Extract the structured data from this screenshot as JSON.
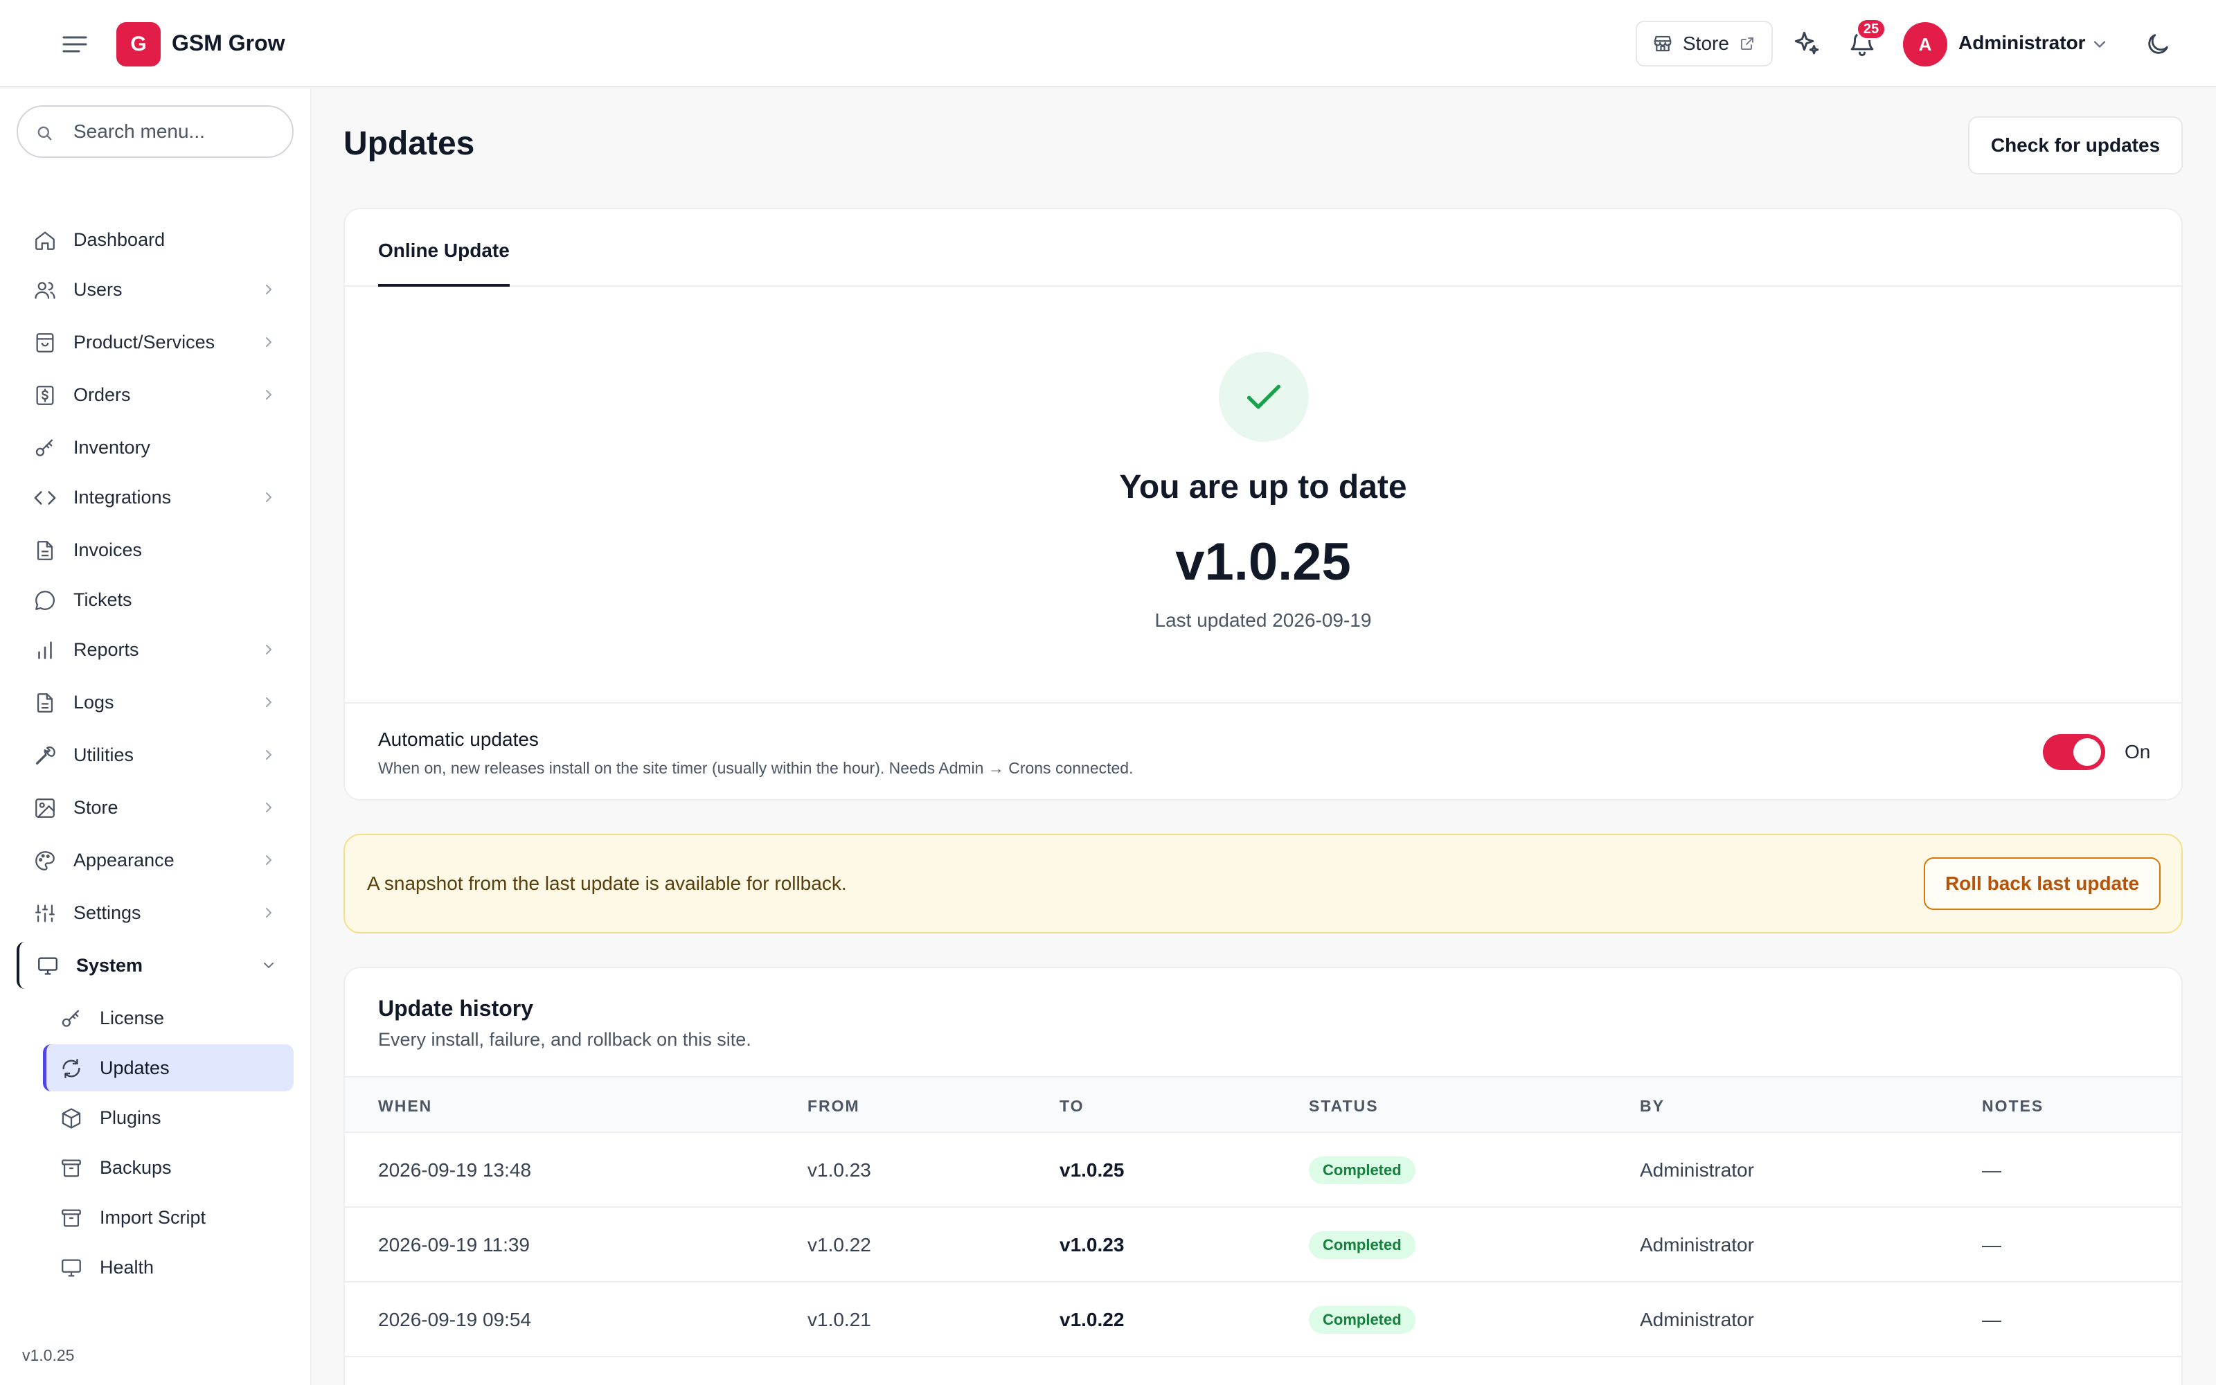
{
  "brand": {
    "logo_letter": "G",
    "name": "GSM Grow"
  },
  "topbar": {
    "store_label": "Store",
    "notifications_count": "25",
    "user_initial": "A",
    "user_name": "Administrator"
  },
  "sidebar": {
    "search_placeholder": "Search menu...",
    "items": [
      {
        "label": "Dashboard",
        "icon": "home-icon"
      },
      {
        "label": "Users",
        "icon": "users-icon"
      },
      {
        "label": "Product/Services",
        "icon": "bag-icon"
      },
      {
        "label": "Orders",
        "icon": "dollar-icon"
      },
      {
        "label": "Inventory",
        "icon": "key-icon"
      },
      {
        "label": "Integrations",
        "icon": "code-icon"
      },
      {
        "label": "Invoices",
        "icon": "file-icon"
      },
      {
        "label": "Tickets",
        "icon": "chat-icon"
      },
      {
        "label": "Reports",
        "icon": "bar-chart-icon"
      },
      {
        "label": "Logs",
        "icon": "file-icon"
      },
      {
        "label": "Utilities",
        "icon": "wrench-icon"
      },
      {
        "label": "Store",
        "icon": "image-icon"
      },
      {
        "label": "Appearance",
        "icon": "palette-icon"
      },
      {
        "label": "Settings",
        "icon": "sliders-icon"
      },
      {
        "label": "System",
        "icon": "monitor-icon"
      }
    ],
    "system_children": [
      {
        "label": "License",
        "icon": "key-icon"
      },
      {
        "label": "Updates",
        "icon": "refresh-icon"
      },
      {
        "label": "Plugins",
        "icon": "box-icon"
      },
      {
        "label": "Backups",
        "icon": "archive-icon"
      },
      {
        "label": "Import Script",
        "icon": "archive-icon"
      },
      {
        "label": "Health",
        "icon": "monitor-icon"
      }
    ],
    "version": "v1.0.25"
  },
  "main": {
    "title": "Updates",
    "check_button": "Check for updates",
    "tab_label": "Online Update",
    "status_heading": "You are up to date",
    "current_version": "v1.0.25",
    "last_updated": "Last updated 2026-09-19",
    "auto_updates": {
      "title": "Automatic updates",
      "description": "When on, new releases install on the site timer (usually within the hour). Needs Admin → Crons connected.",
      "state_label": "On",
      "enabled": true
    },
    "rollback": {
      "message": "A snapshot from the last update is available for rollback.",
      "button": "Roll back last update"
    },
    "history": {
      "title": "Update history",
      "subtitle": "Every install, failure, and rollback on this site.",
      "columns": [
        "WHEN",
        "FROM",
        "TO",
        "STATUS",
        "BY",
        "NOTES"
      ],
      "rows": [
        {
          "when": "2026-09-19 13:48",
          "from": "v1.0.23",
          "to": "v1.0.25",
          "status": "Completed",
          "by": "Administrator",
          "notes": "—"
        },
        {
          "when": "2026-09-19 11:39",
          "from": "v1.0.22",
          "to": "v1.0.23",
          "status": "Completed",
          "by": "Administrator",
          "notes": "—"
        },
        {
          "when": "2026-09-19 09:54",
          "from": "v1.0.21",
          "to": "v1.0.22",
          "status": "Completed",
          "by": "Administrator",
          "notes": "—"
        }
      ]
    }
  },
  "colors": {
    "brand": "#e11d48",
    "active_nav": "#e0e7ff",
    "success": "#15803d",
    "warning": "#b45309"
  }
}
